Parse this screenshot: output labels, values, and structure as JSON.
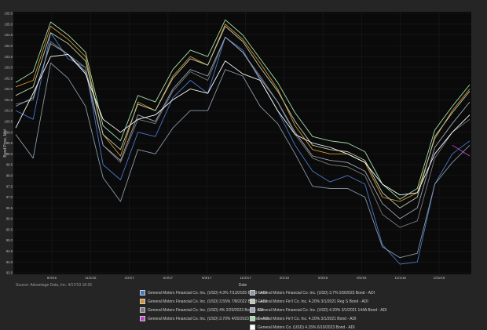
{
  "chart_data": {
    "type": "line",
    "title": "",
    "xlabel": "Date",
    "ylabel": "Bond Price, Mid",
    "ylim": [
      93.5,
      105.5
    ],
    "y_ticks": [
      93.5,
      94.0,
      94.5,
      95.0,
      95.5,
      96.0,
      96.5,
      97.0,
      97.5,
      98.0,
      98.5,
      99.0,
      99.5,
      100.0,
      100.5,
      101.0,
      101.5,
      102.0,
      102.5,
      103.0,
      103.5,
      104.0,
      104.5,
      105.0,
      105.5
    ],
    "y_tick_labels": [
      "93.5",
      "94.0",
      "94.5",
      "95.0",
      "95.5",
      "96.0",
      "96.5",
      "97.0",
      "97.5",
      "98.0",
      "98.5",
      "99.0",
      "99.5",
      "100.0",
      "100.5",
      "101.0",
      "101.5",
      "102.0",
      "102.5",
      "103.0",
      "103.5",
      "104.0",
      "104.5",
      "105.0",
      "105.5"
    ],
    "x_ticks": [
      "8/4/16",
      "11/2/16",
      "2/2/17",
      "5/4/17",
      "8/3/17",
      "11/2/17",
      "2/1/18",
      "5/3/18",
      "8/2/18",
      "11/1/18",
      "1/31/19"
    ],
    "grid": true,
    "legend_position": "bottom",
    "series": [
      {
        "name": "General Motors Financial Co. Inc. (USD) 4.3% 7/13/2025 Bond - ADI",
        "color": "#4a78c8",
        "values": [
          101.0,
          100.6,
          104.6,
          103.4,
          103.0,
          98.5,
          97.8,
          100.0,
          99.8,
          101.6,
          102.4,
          101.8,
          104.4,
          103.8,
          102.4,
          101.0,
          99.4,
          98.2,
          97.7,
          98.0,
          97.6,
          94.8,
          93.9,
          94.0,
          97.6,
          99.0,
          99.6
        ]
      },
      {
        "name": "General Motors Financial Co. Inc. (USD) 3.55% 7/8/2022 Bond - ADI",
        "color": "#d4952e",
        "values": [
          102.1,
          102.4,
          104.9,
          104.3,
          103.5,
          99.9,
          98.9,
          101.4,
          101.0,
          102.6,
          103.5,
          103.1,
          105.0,
          104.3,
          103.2,
          102.0,
          100.3,
          99.2,
          99.0,
          99.0,
          98.6,
          97.0,
          96.8,
          97.2,
          99.7,
          101.0,
          102.0
        ]
      },
      {
        "name": "General Motors Financial Co. Inc. (USD) 4% 2/20/2023 Bond - ADI",
        "color": "#7a7a7a",
        "values": [
          101.3,
          101.5,
          104.2,
          103.6,
          103.0,
          99.4,
          98.6,
          100.6,
          100.4,
          101.9,
          102.8,
          102.4,
          104.4,
          103.7,
          102.6,
          101.4,
          99.9,
          98.8,
          98.5,
          98.4,
          98.0,
          96.2,
          95.6,
          95.9,
          98.8,
          100.0,
          100.6
        ]
      },
      {
        "name": "General Motors Financial Co. Inc. (USD) 3.70% 4/20/2023 Bond - ADI",
        "color": "#c040c8",
        "values": [
          null,
          null,
          null,
          null,
          null,
          null,
          null,
          null,
          null,
          null,
          null,
          null,
          null,
          null,
          null,
          null,
          null,
          null,
          null,
          null,
          null,
          null,
          null,
          null,
          null,
          99.4,
          98.9
        ]
      },
      {
        "name": "General Motors Financial Co. Inc. (USD) 3.7% 5/9/2023 Bond - ADI",
        "color": "#8a9aa8",
        "values": [
          99.9,
          98.8,
          103.2,
          102.5,
          101.2,
          97.9,
          96.8,
          99.2,
          99.0,
          100.2,
          101.0,
          101.0,
          102.9,
          102.6,
          101.2,
          100.4,
          99.0,
          97.5,
          97.4,
          97.4,
          97.0,
          94.7,
          94.2,
          94.4,
          97.6,
          98.6,
          99.4
        ]
      },
      {
        "name": "General Motors Fin'l Co. Inc. 4.20% 3/1/2021 Reg S Bond - ADI",
        "color": "#b8ccb0",
        "values": [
          101.7,
          102.1,
          104.6,
          104.1,
          103.3,
          99.9,
          99.2,
          101.3,
          101.0,
          102.5,
          103.4,
          103.1,
          104.9,
          104.2,
          103.0,
          101.9,
          100.5,
          99.4,
          99.2,
          99.1,
          98.7,
          97.2,
          96.5,
          97.0,
          99.8,
          100.9,
          101.9
        ]
      },
      {
        "name": "General Motors Financial Co. Inc. (USD) 4.20% 3/1/2021 144A Bond - ADI",
        "color": "#9aa8b8",
        "values": [
          101.2,
          101.6,
          104.1,
          103.6,
          102.8,
          99.4,
          98.7,
          100.8,
          100.5,
          102.0,
          102.9,
          102.6,
          104.4,
          103.7,
          102.5,
          101.4,
          100.0,
          98.9,
          98.7,
          98.6,
          98.2,
          96.7,
          96.0,
          96.5,
          99.3,
          100.4,
          101.4
        ]
      },
      {
        "name": "General Motors Fin'l Co. Inc. 4.20% 3/1/2021 Bond - ADI",
        "color": "#a0e0a8",
        "values": [
          102.3,
          102.8,
          105.1,
          104.5,
          103.7,
          100.3,
          99.6,
          101.7,
          101.4,
          102.9,
          103.8,
          103.5,
          105.2,
          104.5,
          103.4,
          102.3,
          100.9,
          99.8,
          99.6,
          99.5,
          99.1,
          97.6,
          96.9,
          97.4,
          100.1,
          101.2,
          102.2
        ]
      },
      {
        "name": "General Motors Co. (USD) 4.15% 6/19/2023 Bond - ADI",
        "color": "#ffffff",
        "values": [
          100.2,
          101.8,
          103.5,
          103.6,
          102.7,
          100.6,
          100.0,
          100.6,
          100.8,
          101.5,
          102.0,
          101.8,
          103.3,
          102.7,
          102.4,
          101.0,
          99.9,
          99.5,
          99.3,
          99.0,
          98.6,
          97.6,
          97.1,
          97.2,
          99.0,
          100.0,
          100.8
        ]
      }
    ],
    "legend_layout": [
      [
        "General Motors Financial Co. Inc. (USD) 4.3% 7/13/2025 Bond - ADI",
        "General Motors Financial Co. Inc. (USD) 3.7% 5/9/2023 Bond - ADI"
      ],
      [
        "General Motors Financial Co. Inc. (USD) 3.55% 7/8/2022 Bond - ADI",
        "General Motors Fin'l Co. Inc. 4.20% 3/1/2021 Reg S Bond - ADI"
      ],
      [
        "General Motors Financial Co. Inc. (USD) 4% 2/20/2023 Bond - ADI",
        "General Motors Financial Co. Inc. (USD) 4.20% 3/1/2021 144A Bond - ADI"
      ],
      [
        "General Motors Financial Co. Inc. (USD) 3.70% 4/20/2023 Bond - ADI",
        "General Motors Fin'l Co. Inc. 4.20% 3/1/2021 Bond - ADI"
      ],
      [
        null,
        "General Motors Co. (USD) 4.15% 6/19/2023 Bond - ADI"
      ]
    ]
  },
  "footer": {
    "source": "Source: Advantage Data, Inc. 4/17/19 18:25"
  }
}
